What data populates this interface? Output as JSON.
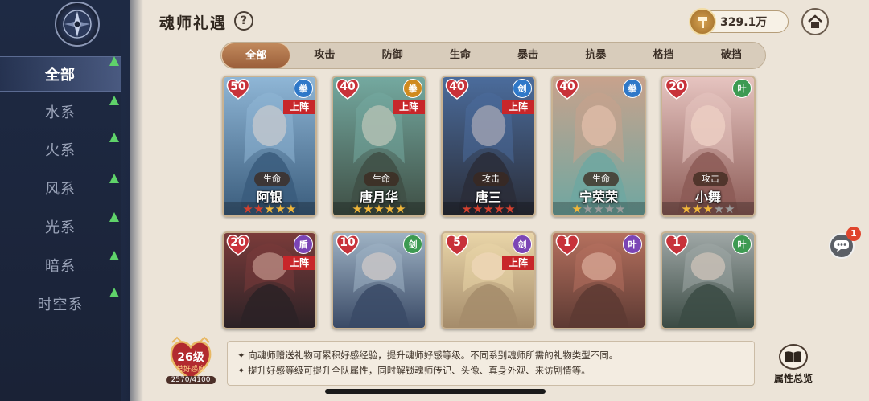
{
  "header": {
    "title": "魂师礼遇",
    "help": "?",
    "currency_amount": "329.1万"
  },
  "sidebar": {
    "items": [
      {
        "label": "全部",
        "active": true
      },
      {
        "label": "水系"
      },
      {
        "label": "火系"
      },
      {
        "label": "风系"
      },
      {
        "label": "光系"
      },
      {
        "label": "暗系"
      },
      {
        "label": "时空系"
      }
    ]
  },
  "tabs": [
    "全部",
    "攻击",
    "防御",
    "生命",
    "暴击",
    "抗暴",
    "格挡",
    "破挡"
  ],
  "lineup_label": "上阵",
  "cards": [
    {
      "level": "50",
      "name": "阿银",
      "role": "生命",
      "lineup": true,
      "stars": [
        "r",
        "r",
        "g",
        "g",
        "g"
      ],
      "badge": "fist",
      "badge_color": "#2f78c8",
      "colors": [
        "#8fb6d6",
        "#3a5c7c"
      ]
    },
    {
      "level": "40",
      "name": "唐月华",
      "role": "生命",
      "lineup": true,
      "stars": [
        "g",
        "g",
        "g",
        "g",
        "g"
      ],
      "badge": "fist",
      "badge_color": "#d08a1e",
      "colors": [
        "#74a9a0",
        "#3f4f45"
      ]
    },
    {
      "level": "40",
      "name": "唐三",
      "role": "攻击",
      "lineup": true,
      "stars": [
        "r",
        "r",
        "r",
        "r",
        "r"
      ],
      "badge": "sword",
      "badge_color": "#2f78c8",
      "colors": [
        "#4b6c9c",
        "#2a2d38"
      ]
    },
    {
      "level": "40",
      "name": "宁荣荣",
      "role": "生命",
      "lineup": false,
      "stars": [
        "g",
        "o",
        "o",
        "o",
        "o"
      ],
      "badge": "fist",
      "badge_color": "#2f78c8",
      "colors": [
        "#c8a28c",
        "#6fa7a1"
      ]
    },
    {
      "level": "20",
      "name": "小舞",
      "role": "攻击",
      "lineup": false,
      "stars": [
        "g",
        "g",
        "g",
        "o",
        "o"
      ],
      "badge": "leaf",
      "badge_color": "#3d9a52",
      "colors": [
        "#e6c4c0",
        "#8c5b56"
      ]
    },
    {
      "level": "20",
      "name": "",
      "role": "",
      "lineup": true,
      "stars": [],
      "badge": "shield",
      "badge_color": "#7b45b5",
      "colors": [
        "#7a3b3a",
        "#2c2226"
      ]
    },
    {
      "level": "10",
      "name": "",
      "role": "",
      "lineup": false,
      "stars": [],
      "badge": "sword",
      "badge_color": "#3d9a52",
      "colors": [
        "#9eb2c4",
        "#3a4a66"
      ]
    },
    {
      "level": "5",
      "name": "",
      "role": "",
      "lineup": true,
      "stars": [],
      "badge": "sword",
      "badge_color": "#7b45b5",
      "colors": [
        "#e9d5a8",
        "#a58c6b"
      ]
    },
    {
      "level": "1",
      "name": "",
      "role": "",
      "lineup": false,
      "stars": [],
      "badge": "leaf",
      "badge_color": "#7b45b5",
      "colors": [
        "#b5705e",
        "#5d3a33"
      ]
    },
    {
      "level": "1",
      "name": "",
      "role": "",
      "lineup": false,
      "stars": [],
      "badge": "leaf",
      "badge_color": "#3d9a52",
      "colors": [
        "#9fa7a6",
        "#3b4b44"
      ]
    }
  ],
  "footer": {
    "level_label": "26级",
    "level_sub": "总好感度",
    "xp": "2570/4100",
    "info_lines": [
      "✦ 向魂师赠送礼物可累积好感经验，提升魂师好感等级。不同系别魂师所需的礼物类型不同。",
      "✦ 提升好感等级可提升全队属性，同时解锁魂师传记、头像、真身外观、来访剧情等。"
    ],
    "attr_label": "属性总览"
  },
  "chat_badge": "1",
  "colors": {
    "accent": "#9c603b",
    "lineup": "#c8262a",
    "sidebar": "#1e2a44",
    "star": "#f0b63a"
  }
}
